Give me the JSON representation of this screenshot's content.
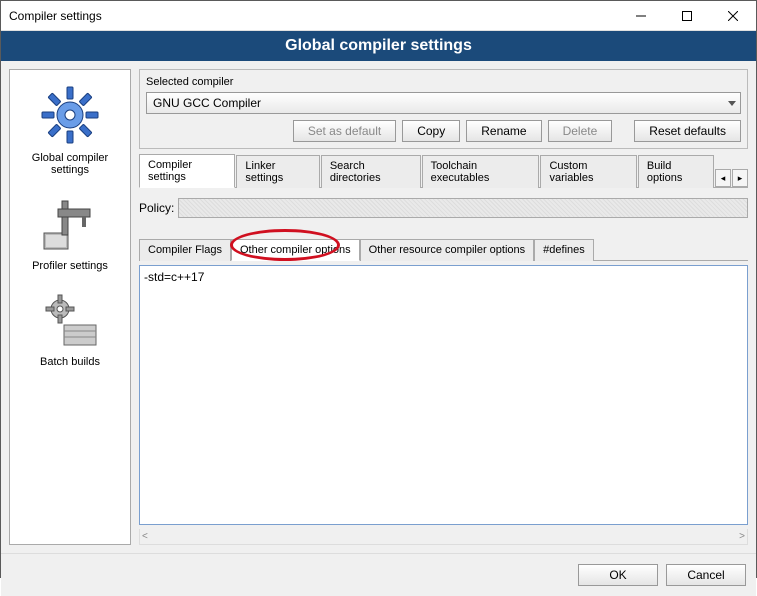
{
  "window": {
    "title": "Compiler settings"
  },
  "banner": {
    "title": "Global compiler settings"
  },
  "sidebar": {
    "items": [
      {
        "label": "Global compiler settings"
      },
      {
        "label": "Profiler settings"
      },
      {
        "label": "Batch builds"
      }
    ]
  },
  "selected_compiler": {
    "label": "Selected compiler",
    "value": "GNU GCC Compiler",
    "buttons": {
      "set_default": "Set as default",
      "copy": "Copy",
      "rename": "Rename",
      "delete": "Delete",
      "reset_defaults": "Reset defaults"
    }
  },
  "main_tabs": {
    "items": [
      "Compiler settings",
      "Linker settings",
      "Search directories",
      "Toolchain executables",
      "Custom variables",
      "Build options"
    ],
    "active": 0
  },
  "policy": {
    "label": "Policy:"
  },
  "sub_tabs": {
    "items": [
      "Compiler Flags",
      "Other compiler options",
      "Other resource compiler options",
      "#defines"
    ],
    "active": 1
  },
  "editor": {
    "value": "-std=c++17"
  },
  "footer": {
    "ok": "OK",
    "cancel": "Cancel"
  }
}
